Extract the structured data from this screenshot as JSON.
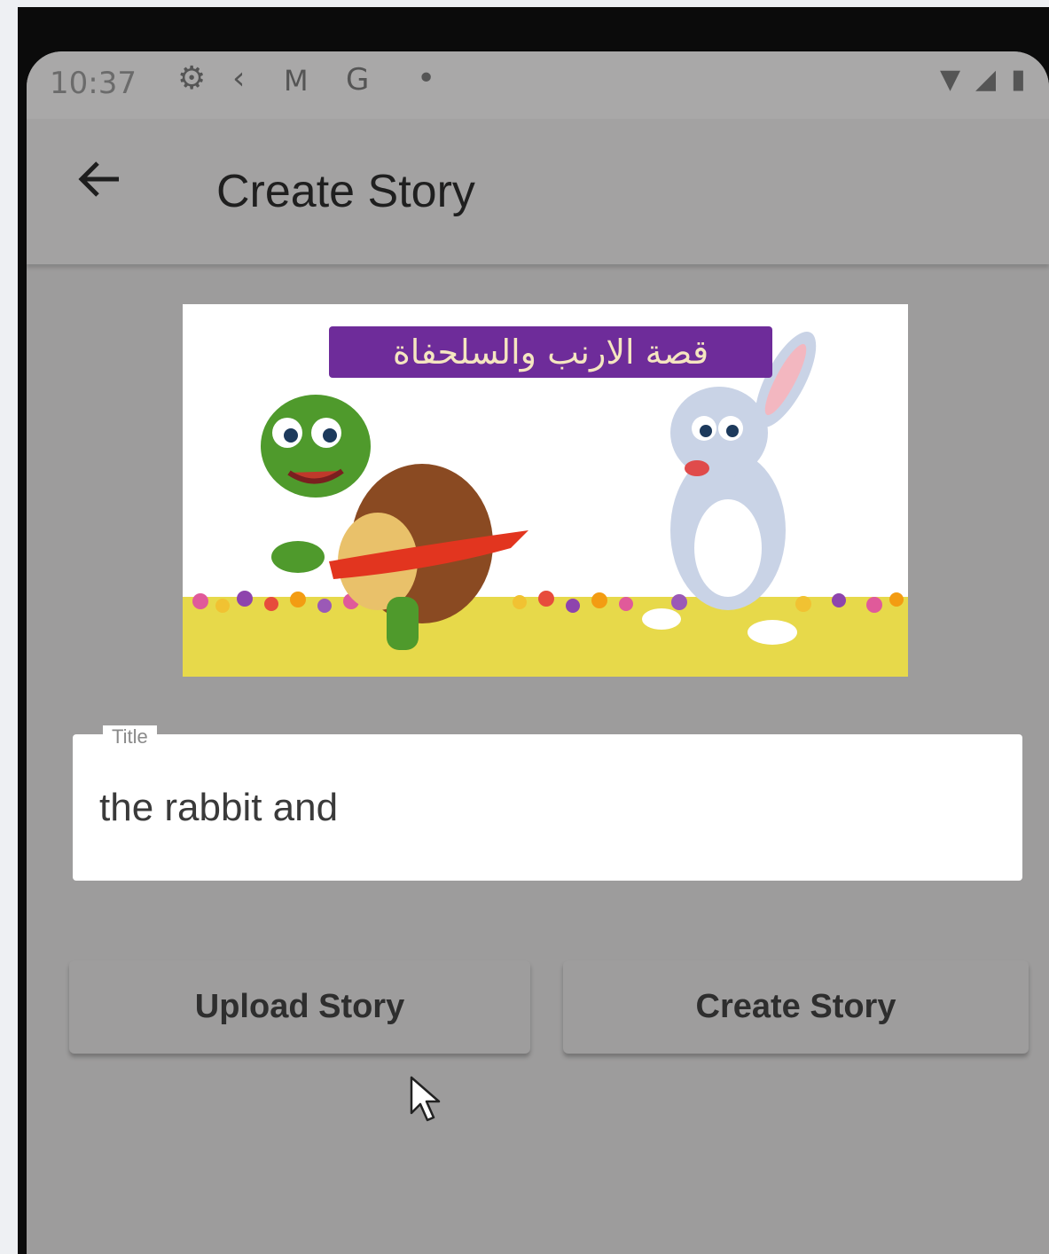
{
  "status_bar": {
    "time": "10:37",
    "icons": [
      "gear-icon",
      "flutter-icon",
      "gmail-icon",
      "google-icon",
      "dot-icon",
      "wifi-icon",
      "signal-icon",
      "battery-icon"
    ]
  },
  "app_bar": {
    "back_icon": "arrow-left-icon",
    "title": "Create Story"
  },
  "banner": {
    "arabic_title": "قصة الارنب والسلحفاة"
  },
  "title_field": {
    "label": "Title",
    "value": "the rabbit and"
  },
  "buttons": {
    "upload": "Upload Story",
    "create": "Create Story"
  },
  "colors": {
    "screen_bg": "#9d9c9c",
    "banner_title_bg": "#6e2c9a"
  }
}
